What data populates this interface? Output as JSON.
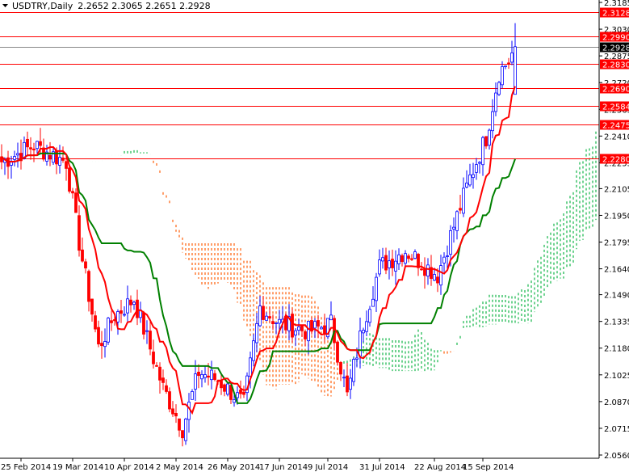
{
  "chart_data": {
    "type": "candlestick",
    "title": "USDTRY,Daily",
    "ohlc_header": "2.2652 2.3065 2.2651 2.2928",
    "ylim": [
      2.056,
      2.3185
    ],
    "y_ticks": [
      "2.3185",
      "2.3030",
      "2.2875",
      "2.2720",
      "2.2565",
      "2.2410",
      "2.2255",
      "2.2105",
      "2.1950",
      "2.1795",
      "2.1640",
      "2.1490",
      "2.1335",
      "2.1180",
      "2.1025",
      "2.0870",
      "2.0715",
      "2.0560"
    ],
    "x_ticks": [
      {
        "label": "25 Feb 2014",
        "bar": 6
      },
      {
        "label": "19 Mar 2014",
        "bar": 22
      },
      {
        "label": "10 Apr 2014",
        "bar": 38
      },
      {
        "label": "2 May 2014",
        "bar": 54
      },
      {
        "label": "26 May 2014",
        "bar": 70
      },
      {
        "label": "17 Jun 2014",
        "bar": 86
      },
      {
        "label": "9 Jul 2014",
        "bar": 101
      },
      {
        "label": "31 Jul 2014",
        "bar": 117
      },
      {
        "label": "22 Aug 2014",
        "bar": 134
      },
      {
        "label": "15 Sep 2014",
        "bar": 149
      }
    ],
    "bars": 160,
    "close_path": [
      [
        0,
        2.2261
      ],
      [
        10,
        2.2355
      ],
      [
        20,
        2.2261
      ],
      [
        24,
        2.1793
      ],
      [
        30,
        2.1183
      ],
      [
        35,
        2.1371
      ],
      [
        41,
        2.1464
      ],
      [
        50,
        2.0949
      ],
      [
        56,
        2.0714
      ],
      [
        61,
        2.1042
      ],
      [
        67,
        2.0996
      ],
      [
        75,
        2.0855
      ],
      [
        80,
        2.1418
      ],
      [
        86,
        2.1324
      ],
      [
        95,
        2.1277
      ],
      [
        102,
        2.1324
      ],
      [
        107,
        2.0902
      ],
      [
        112,
        2.1324
      ],
      [
        117,
        2.1652
      ],
      [
        125,
        2.1746
      ],
      [
        135,
        2.1605
      ],
      [
        140,
        2.1887
      ],
      [
        145,
        2.2168
      ],
      [
        150,
        2.2402
      ],
      [
        154,
        2.2777
      ],
      [
        157,
        2.2847
      ],
      [
        159,
        2.2928
      ]
    ],
    "current_price": {
      "label": "2.2928",
      "value": 2.2928
    },
    "levels": [
      {
        "label": "2.3128",
        "value": 2.3128
      },
      {
        "label": "2.2990",
        "value": 2.299
      },
      {
        "label": "2.2830",
        "value": 2.283
      },
      {
        "label": "2.2690",
        "value": 2.269
      },
      {
        "label": "2.2584",
        "value": 2.2584
      },
      {
        "label": "2.2475",
        "value": 2.2475
      },
      {
        "label": "2.2280",
        "value": 2.228
      }
    ],
    "indicators": [
      "Ichimoku Tenkan-sen (9)",
      "Ichimoku Kijun-sen (26)",
      "Ichimoku Cloud"
    ],
    "colors": {
      "bull": "#0000ff",
      "bear": "#ff0000",
      "tenkan": "#ff0000",
      "kijun": "#008000",
      "cloud_up": "#22bb55",
      "cloud_down": "#ff6a1a",
      "level": "#ff0000",
      "current": "#000000"
    }
  }
}
